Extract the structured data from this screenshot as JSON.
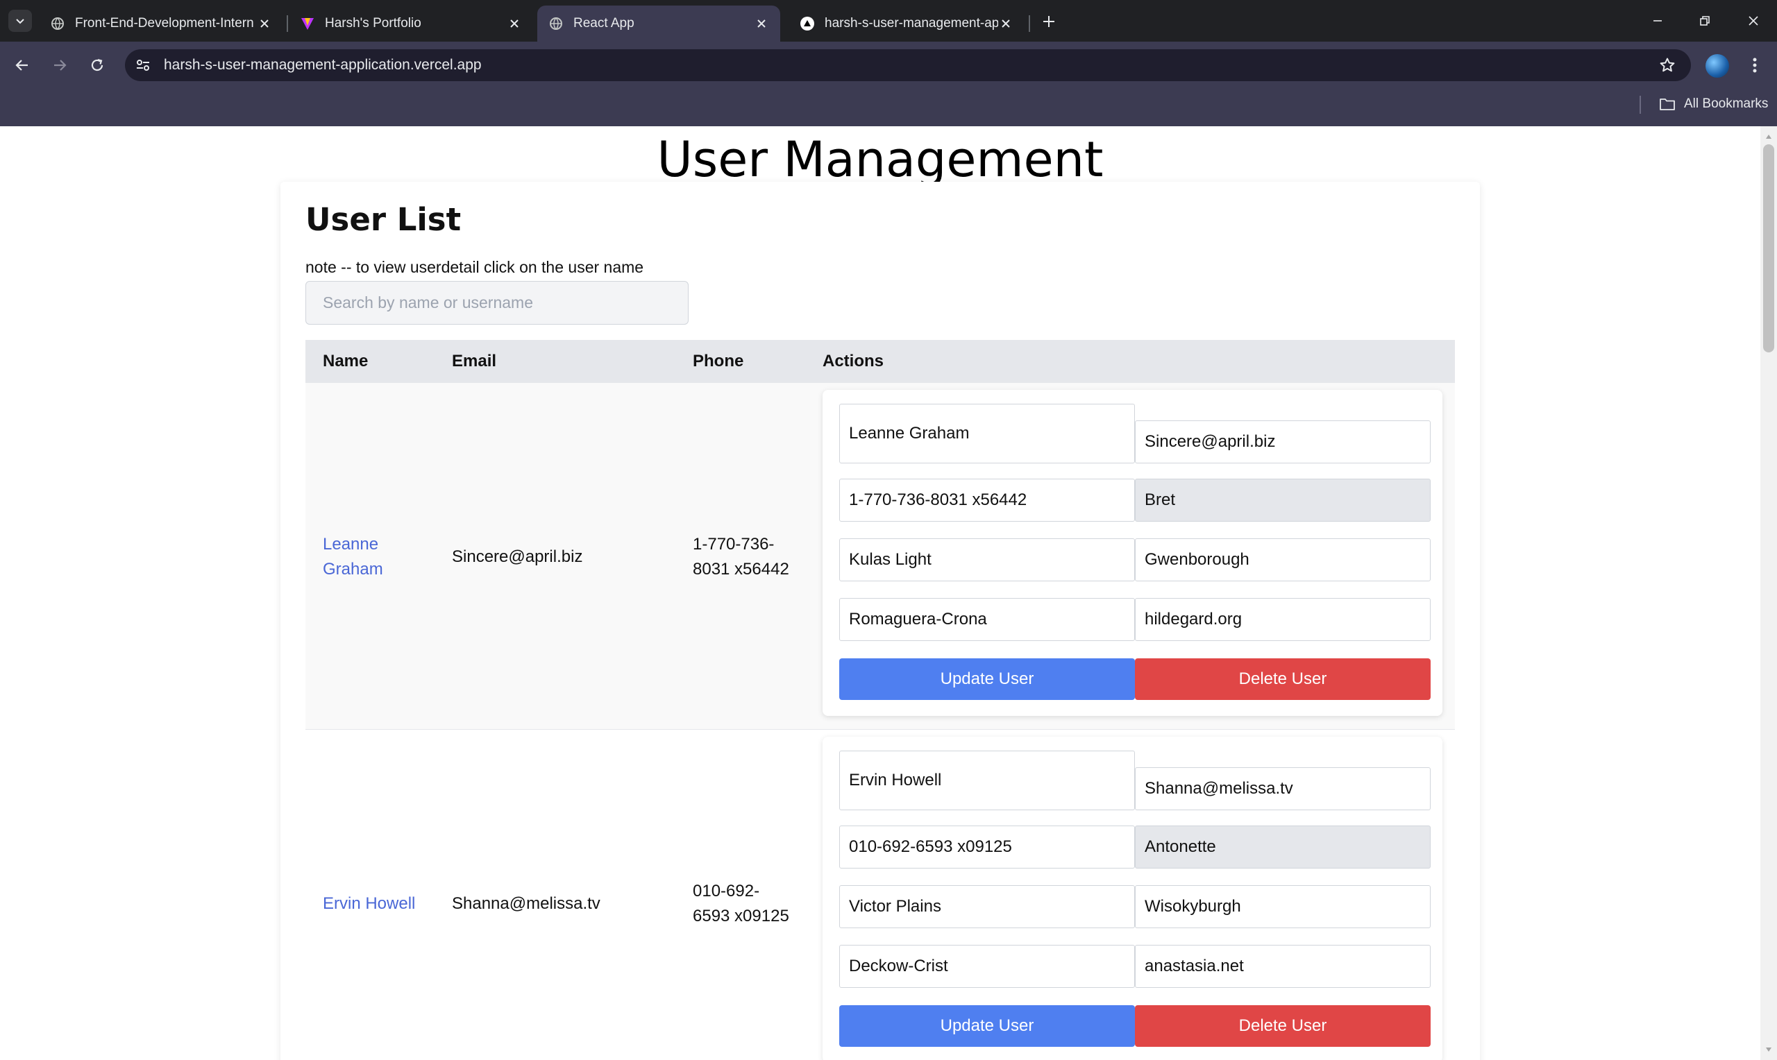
{
  "browser": {
    "tabs": [
      {
        "title": "Front-End-Development-Intern",
        "active": false
      },
      {
        "title": "Harsh's Portfolio",
        "active": false
      },
      {
        "title": "React App",
        "active": true
      },
      {
        "title": "harsh-s-user-management-app",
        "active": false
      }
    ],
    "url": "harsh-s-user-management-application.vercel.app",
    "bookmarks_label": "All Bookmarks"
  },
  "page": {
    "title": "User Management",
    "list_title": "User List",
    "note": "note -- to view userdetail click on the user name",
    "search_placeholder": "Search by name or username"
  },
  "table": {
    "headers": {
      "name": "Name",
      "email": "Email",
      "phone": "Phone",
      "actions": "Actions"
    },
    "rows": [
      {
        "name_line1": "Leanne",
        "name_line2": "Graham",
        "email": "Sincere@april.biz",
        "phone_line1": "1-770-736-",
        "phone_line2": "8031 x56442",
        "form": {
          "name": "Leanne Graham",
          "email": "Sincere@april.biz",
          "phone": "1-770-736-8031 x56442",
          "username": "Bret",
          "street": "Kulas Light",
          "city": "Gwenborough",
          "company": "Romaguera-Crona",
          "website": "hildegard.org"
        },
        "update_label": "Update User",
        "delete_label": "Delete User"
      },
      {
        "name_line1": "Ervin Howell",
        "name_line2": "",
        "email": "Shanna@melissa.tv",
        "phone_line1": "010-692-",
        "phone_line2": "6593 x09125",
        "form": {
          "name": "Ervin Howell",
          "email": "Shanna@melissa.tv",
          "phone": "010-692-6593 x09125",
          "username": "Antonette",
          "street": "Victor Plains",
          "city": "Wisokyburgh",
          "company": "Deckow-Crist",
          "website": "anastasia.net"
        },
        "update_label": "Update User",
        "delete_label": "Delete User"
      }
    ]
  },
  "colors": {
    "link": "#4a67d6",
    "update_button": "#4f7ff0",
    "delete_button": "#e04646",
    "chrome_toolbar": "#3c3b52",
    "tabstrip": "#202124"
  }
}
